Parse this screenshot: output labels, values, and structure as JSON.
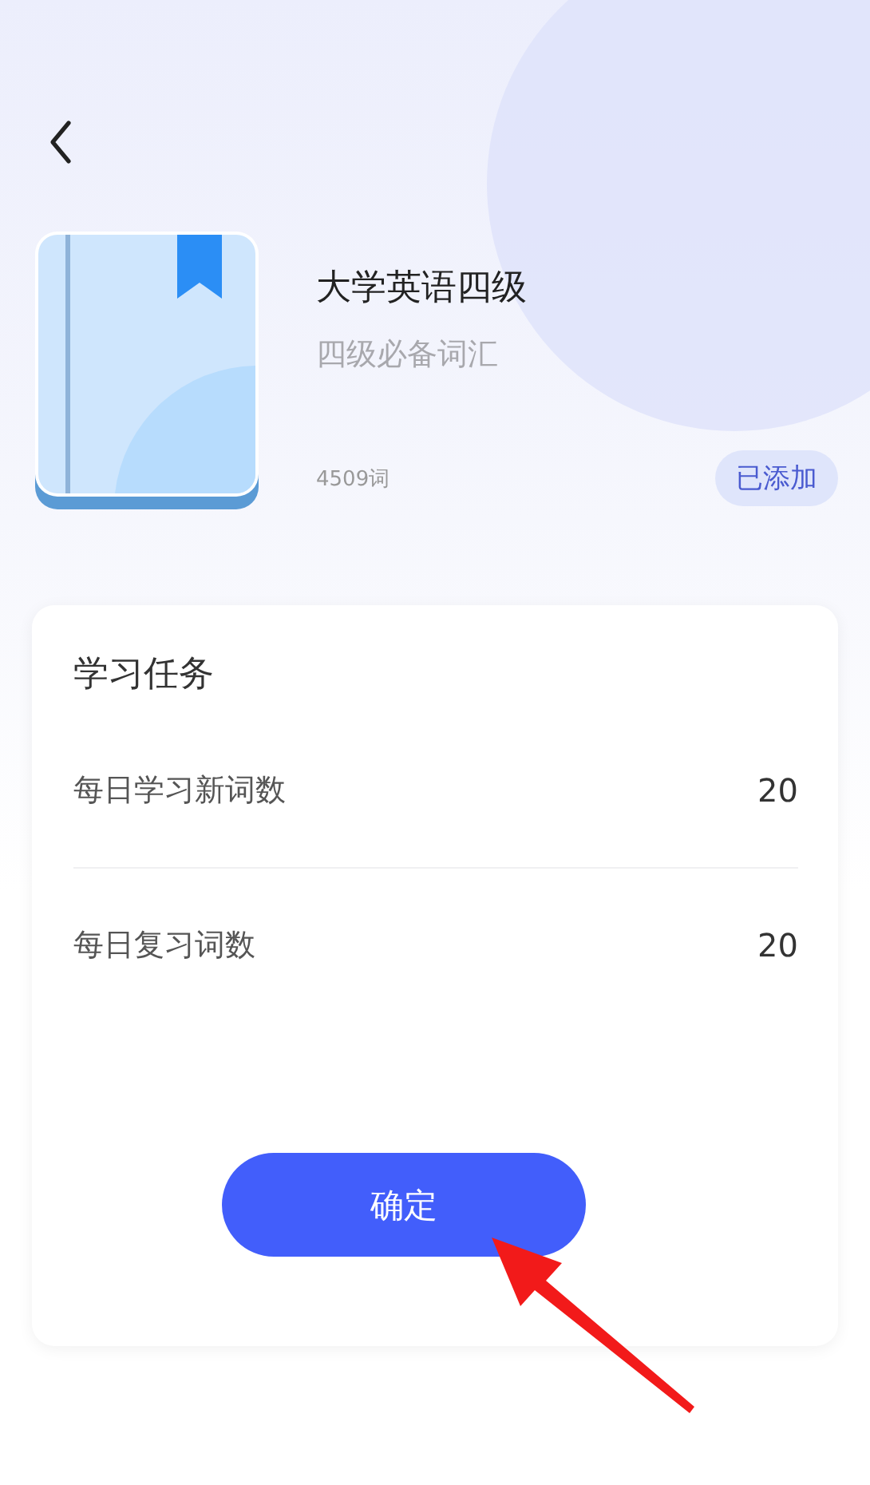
{
  "book": {
    "title": "大学英语四级",
    "subtitle": "四级必备词汇",
    "word_count": "4509词",
    "badge": "已添加"
  },
  "task_card": {
    "title": "学习任务",
    "rows": [
      {
        "label": "每日学习新词数",
        "value": "20"
      },
      {
        "label": "每日复习词数",
        "value": "20"
      }
    ],
    "confirm_button": "确定"
  }
}
